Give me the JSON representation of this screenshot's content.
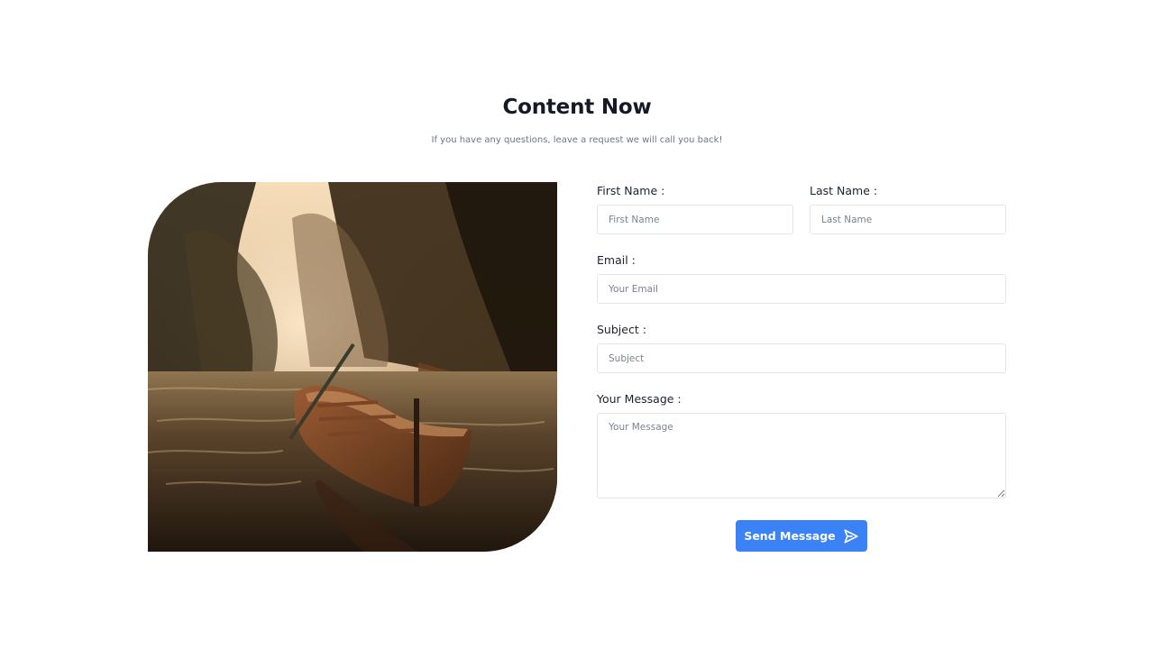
{
  "header": {
    "title": "Content Now",
    "subtitle": "If you have any questions, leave a request we will call you back!"
  },
  "image": {
    "description_icon": "boat-on-river-photo"
  },
  "form": {
    "first_name": {
      "label": "First Name :",
      "placeholder": "First Name",
      "value": ""
    },
    "last_name": {
      "label": "Last Name :",
      "placeholder": "Last Name",
      "value": ""
    },
    "email": {
      "label": "Email :",
      "placeholder": "Your Email",
      "value": ""
    },
    "subject": {
      "label": "Subject :",
      "placeholder": "Subject",
      "value": ""
    },
    "message": {
      "label": "Your Message :",
      "placeholder": "Your Message",
      "value": ""
    },
    "submit": {
      "label": "Send Message",
      "icon": "send-icon"
    }
  },
  "colors": {
    "accent": "#3b82f6",
    "border": "#e2e6ec",
    "heading": "#161a26",
    "muted": "#6c7585"
  }
}
